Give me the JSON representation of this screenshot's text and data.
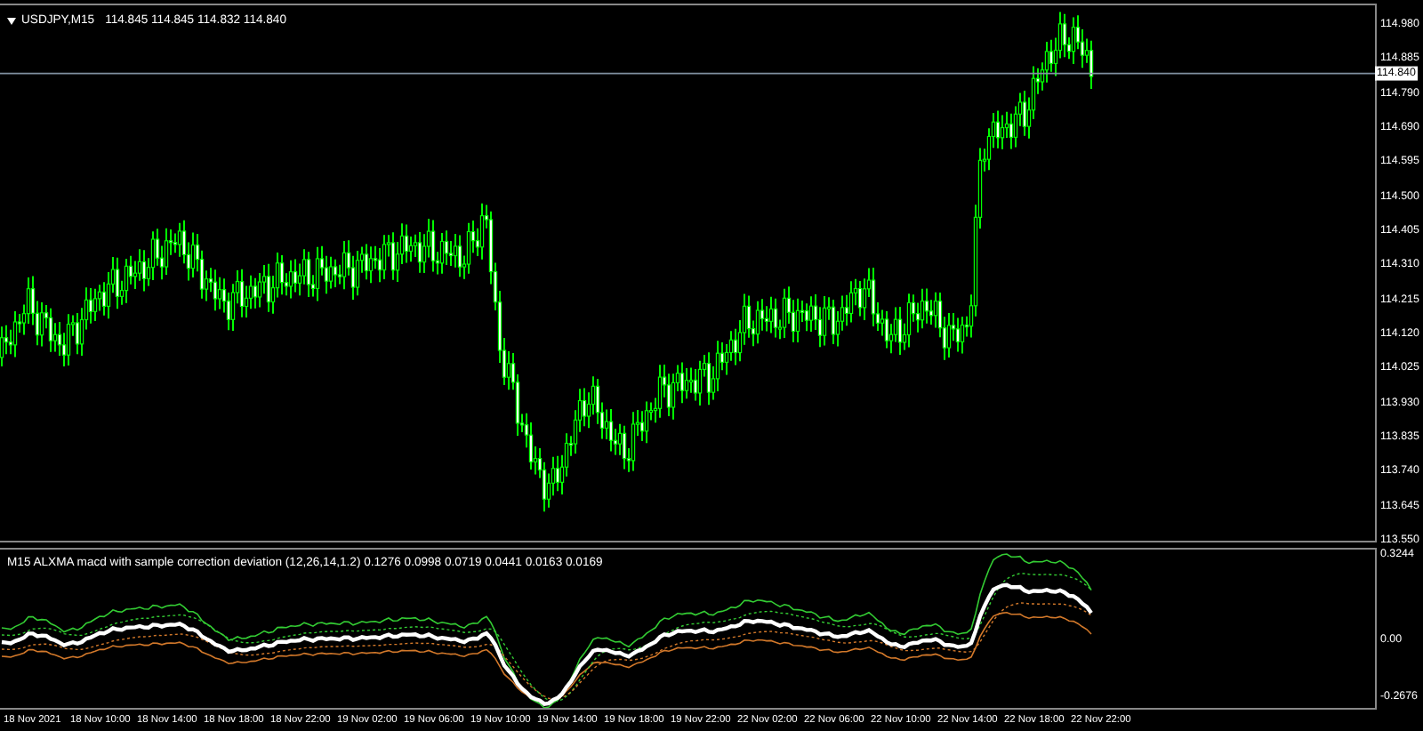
{
  "chart": {
    "symbol": "USDJPY,M15",
    "quotes": "114.845 114.845 114.832 114.840",
    "current_price": "114.840",
    "price_axis": [
      "114.980",
      "114.885",
      "114.790",
      "114.690",
      "114.595",
      "114.500",
      "114.405",
      "114.310",
      "114.215",
      "114.120",
      "114.025",
      "113.930",
      "113.835",
      "113.740",
      "113.645",
      "113.550"
    ]
  },
  "indicator": {
    "label": "M15 ALXMA macd with sample correction deviation (12,26,14,1.2) 0.1276 0.0998 0.0719 0.0441 0.0163 0.0169",
    "axis": [
      "0.3244",
      "0.00",
      "-0.2676"
    ]
  },
  "time_axis": [
    "18 Nov 2021",
    "18 Nov 10:00",
    "18 Nov 14:00",
    "18 Nov 18:00",
    "18 Nov 22:00",
    "19 Nov 02:00",
    "19 Nov 06:00",
    "19 Nov 10:00",
    "19 Nov 14:00",
    "19 Nov 18:00",
    "19 Nov 22:00",
    "22 Nov 02:00",
    "22 Nov 06:00",
    "22 Nov 10:00",
    "22 Nov 14:00",
    "22 Nov 18:00",
    "22 Nov 22:00"
  ]
}
